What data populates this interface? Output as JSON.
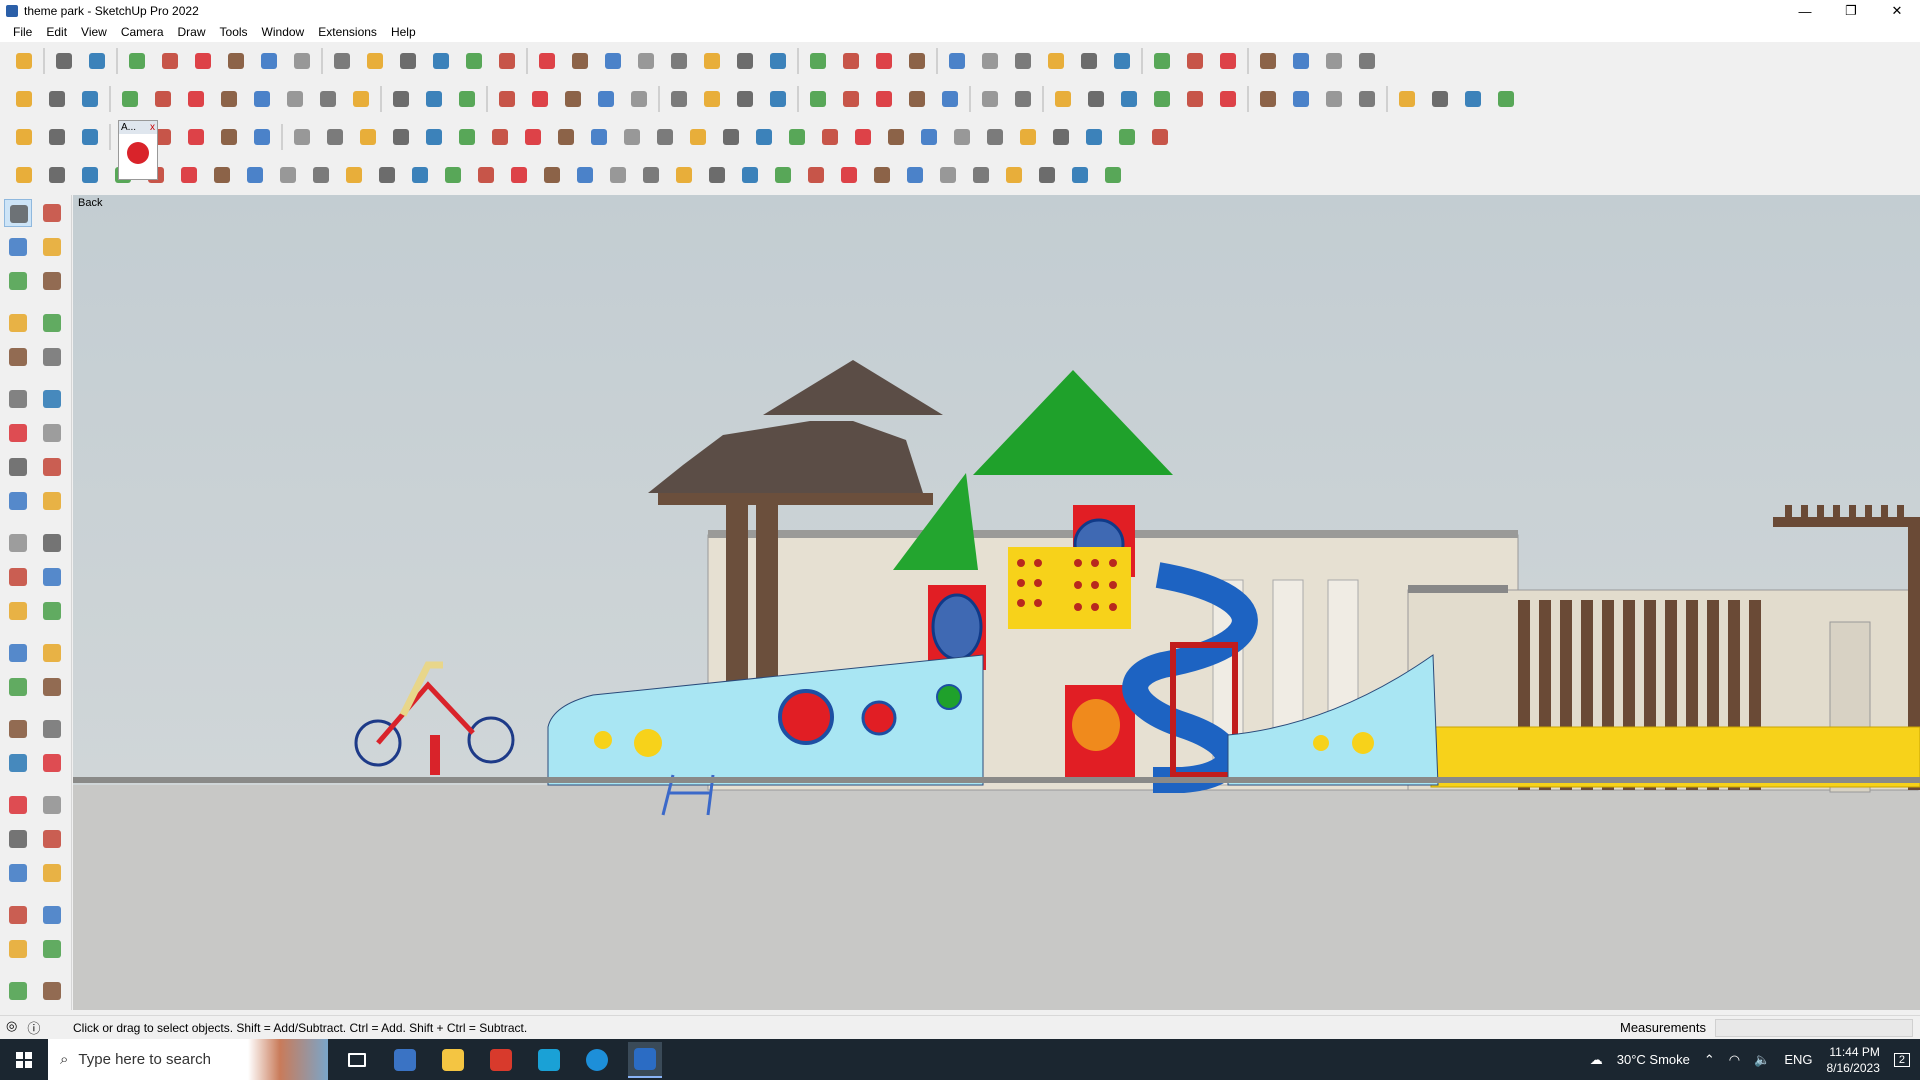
{
  "window": {
    "title": "theme park - SketchUp Pro 2022",
    "controls": [
      "—",
      "❐",
      "✕"
    ]
  },
  "menu": [
    "File",
    "Edit",
    "View",
    "Camera",
    "Draw",
    "Tools",
    "Window",
    "Extensions",
    "Help"
  ],
  "viewport": {
    "scene_label": "Back",
    "ground_color": "#c8c8c6",
    "sky_color": "#c3cdd2"
  },
  "floating_panel": {
    "label": "A...",
    "close": "x"
  },
  "status": {
    "message": "Click or drag to select objects. Shift = Add/Subtract. Ctrl = Add. Shift + Ctrl = Subtract.",
    "measurements_label": "Measurements",
    "measurements_value": ""
  },
  "taskbar": {
    "search_placeholder": "Type here to search",
    "weather": "30°C  Smoke",
    "language": "ENG",
    "time": "11:44 PM",
    "date": "8/16/2023",
    "notifications": "2"
  }
}
